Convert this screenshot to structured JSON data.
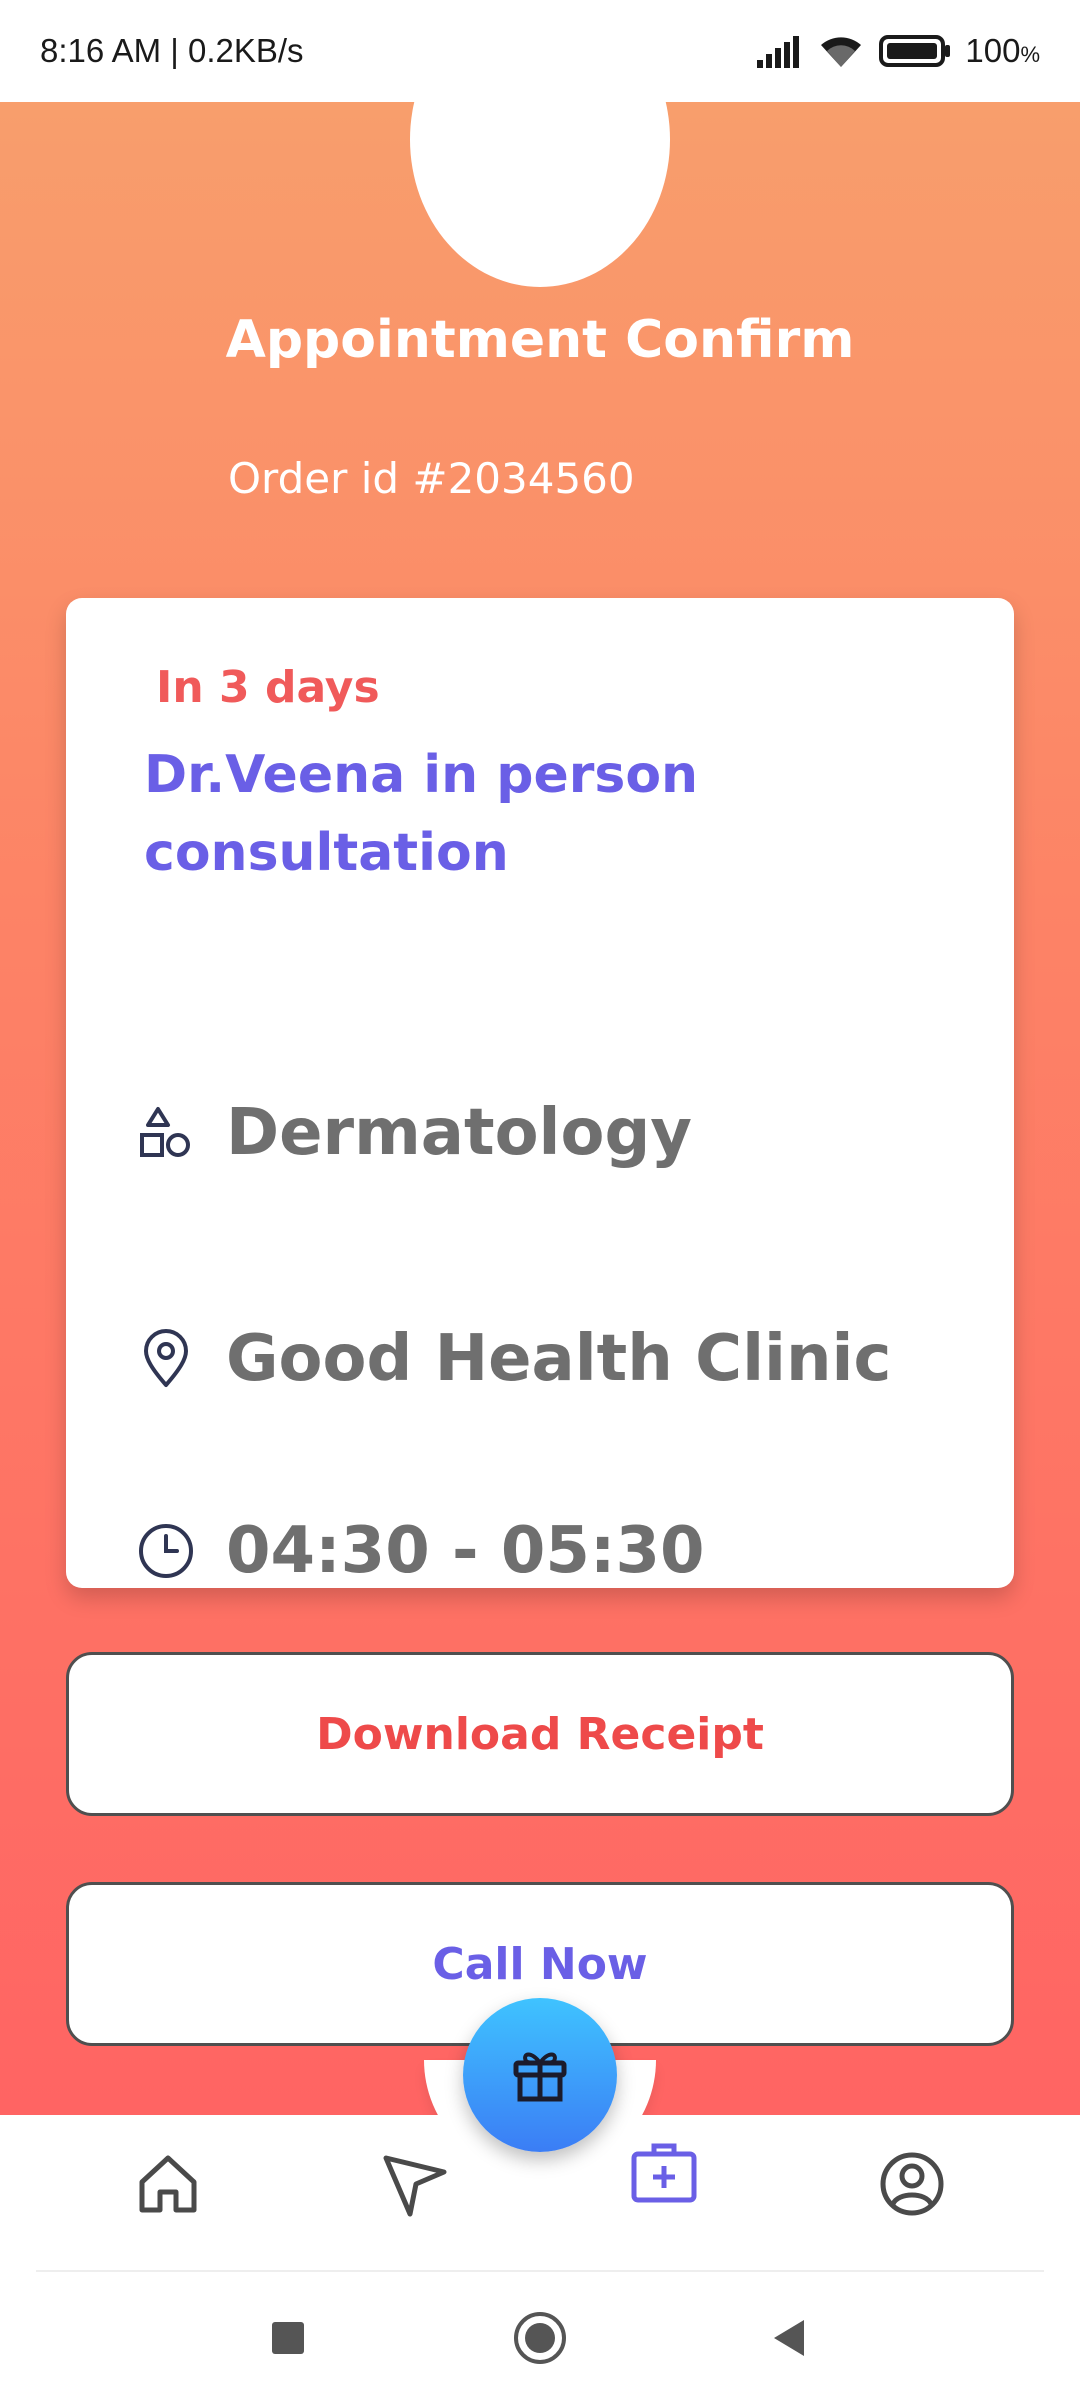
{
  "status_bar": {
    "time": "8:16 AM | 0.2KB/s",
    "battery": "100",
    "battery_unit": "%",
    "icons": [
      "signal-icon",
      "wifi-icon",
      "battery-icon"
    ]
  },
  "header": {
    "title": "Appointment Confirm",
    "order_id": "Order id #2034560"
  },
  "card": {
    "badge": "In 3 days",
    "doctor_title": "Dr.Veena in person consultation",
    "specialty": "Dermatology",
    "clinic": "Good Health Clinic",
    "time_slot": "04:30 - 05:30"
  },
  "buttons": {
    "download": "Download Receipt",
    "call": "Call Now"
  },
  "bottom_nav": {
    "items": [
      "home-icon",
      "send-icon",
      "medical-kit-icon",
      "profile-icon"
    ],
    "active": "medical-kit-icon"
  },
  "colors": {
    "accent_purple": "#6a5fe6",
    "accent_red": "#ee4a4a",
    "gradient_top": "#f89e6c",
    "gradient_bottom": "#ff6463",
    "fab_blue": "#3b7df5"
  }
}
